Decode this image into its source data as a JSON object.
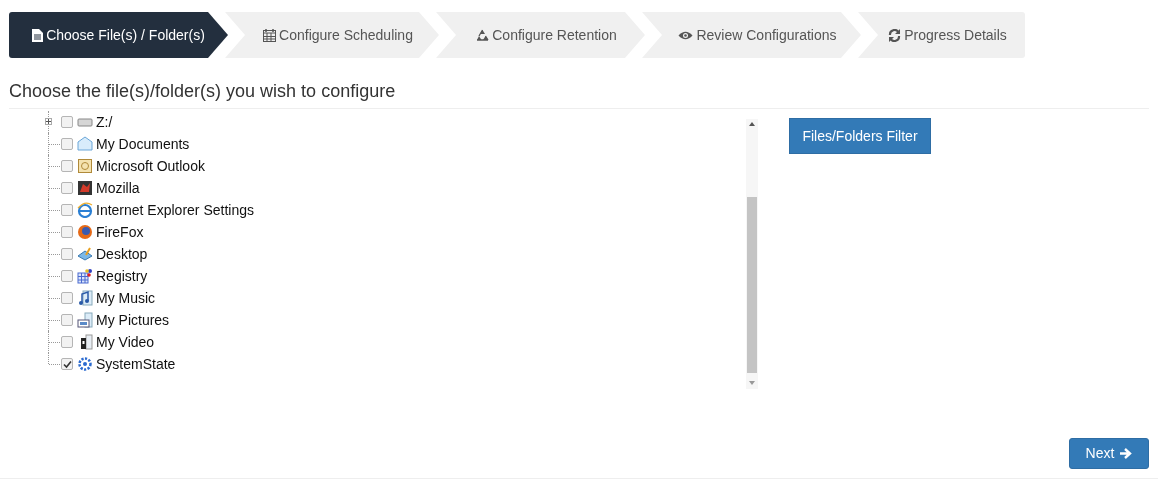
{
  "steps": [
    {
      "label": "Choose File(s) / Folder(s)",
      "selected": true
    },
    {
      "label": "Configure Scheduling",
      "selected": false
    },
    {
      "label": "Configure Retention",
      "selected": false
    },
    {
      "label": "Review Configurations",
      "selected": false
    },
    {
      "label": "Progress Details",
      "selected": false
    }
  ],
  "heading": "Choose the file(s)/folder(s) you wish to configure",
  "tree": [
    {
      "label": "Z:/",
      "checked": false,
      "expanded": false
    },
    {
      "label": "My Documents",
      "checked": false
    },
    {
      "label": "Microsoft Outlook",
      "checked": false
    },
    {
      "label": "Mozilla",
      "checked": false
    },
    {
      "label": "Internet Explorer Settings",
      "checked": false
    },
    {
      "label": "FireFox",
      "checked": false
    },
    {
      "label": "Desktop",
      "checked": false
    },
    {
      "label": "Registry",
      "checked": false
    },
    {
      "label": "My Music",
      "checked": false
    },
    {
      "label": "My Pictures",
      "checked": false
    },
    {
      "label": "My Video",
      "checked": false
    },
    {
      "label": "SystemState",
      "checked": true
    }
  ],
  "filter_button": "Files/Folders Filter",
  "next_button": "Next"
}
